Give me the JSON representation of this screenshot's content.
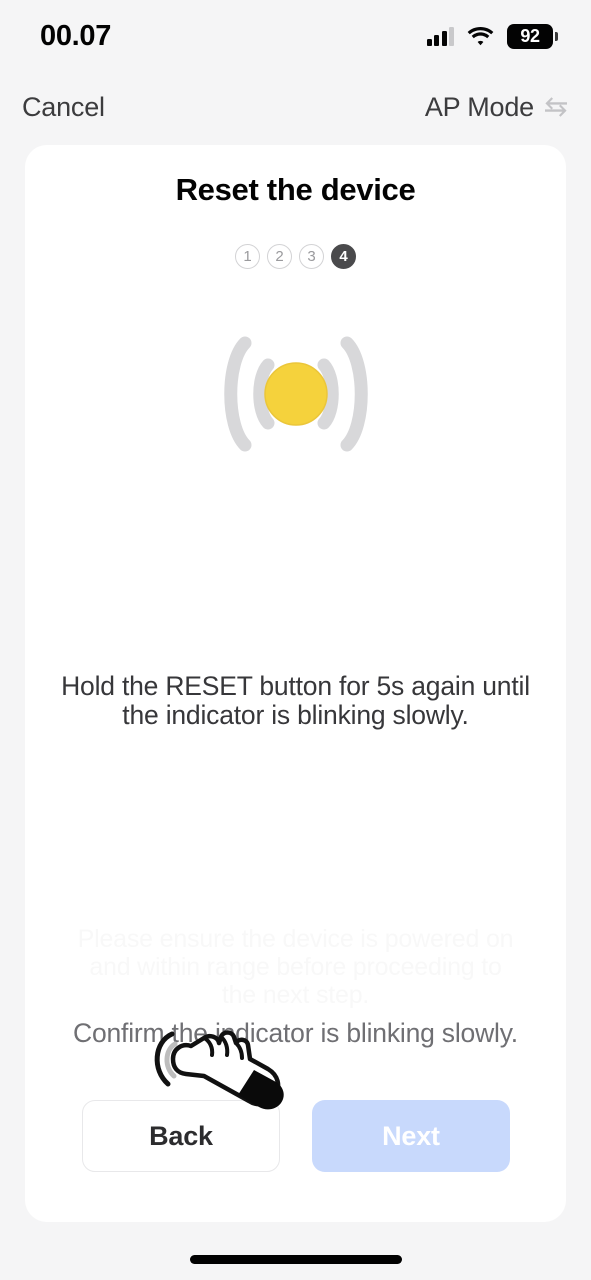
{
  "status_bar": {
    "time": "00.07",
    "battery_percent": "92",
    "signal_icon": "cellular-signal-icon",
    "wifi_icon": "wifi-icon",
    "battery_icon": "battery-icon"
  },
  "nav": {
    "cancel_label": "Cancel",
    "mode_label": "AP Mode",
    "mode_icon": "swap-arrows-icon"
  },
  "card": {
    "title": "Reset the device",
    "steps": [
      {
        "label": "1",
        "active": false
      },
      {
        "label": "2",
        "active": false
      },
      {
        "label": "3",
        "active": false
      },
      {
        "label": "4",
        "active": true
      }
    ],
    "illustration": {
      "icon": "blinking-indicator-icon",
      "dot_color": "#F5D23C",
      "wave_color": "#D8D8DA"
    },
    "instruction": "Hold the RESET button for 5s again until the indicator is blinking slowly.",
    "ghost_text": "Please ensure the device is powered on and within range before proceeding to the next step.",
    "confirm_text": "Confirm the indicator is blinking slowly.",
    "buttons": {
      "back_label": "Back",
      "next_label": "Next",
      "next_color": "#C8D9FC"
    }
  },
  "overlay": {
    "cursor_icon": "tap-hand-cursor-icon"
  },
  "home_indicator": "home-indicator"
}
